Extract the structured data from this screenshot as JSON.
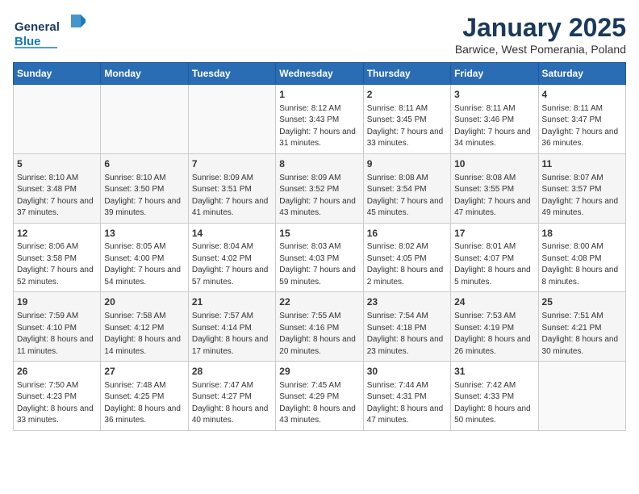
{
  "header": {
    "logo_general": "General",
    "logo_blue": "Blue",
    "title": "January 2025",
    "subtitle": "Barwice, West Pomerania, Poland"
  },
  "calendar": {
    "weekdays": [
      "Sunday",
      "Monday",
      "Tuesday",
      "Wednesday",
      "Thursday",
      "Friday",
      "Saturday"
    ],
    "weeks": [
      [
        {
          "day": "",
          "sunrise": "",
          "sunset": "",
          "daylight": ""
        },
        {
          "day": "",
          "sunrise": "",
          "sunset": "",
          "daylight": ""
        },
        {
          "day": "",
          "sunrise": "",
          "sunset": "",
          "daylight": ""
        },
        {
          "day": "1",
          "sunrise": "Sunrise: 8:12 AM",
          "sunset": "Sunset: 3:43 PM",
          "daylight": "Daylight: 7 hours and 31 minutes."
        },
        {
          "day": "2",
          "sunrise": "Sunrise: 8:11 AM",
          "sunset": "Sunset: 3:45 PM",
          "daylight": "Daylight: 7 hours and 33 minutes."
        },
        {
          "day": "3",
          "sunrise": "Sunrise: 8:11 AM",
          "sunset": "Sunset: 3:46 PM",
          "daylight": "Daylight: 7 hours and 34 minutes."
        },
        {
          "day": "4",
          "sunrise": "Sunrise: 8:11 AM",
          "sunset": "Sunset: 3:47 PM",
          "daylight": "Daylight: 7 hours and 36 minutes."
        }
      ],
      [
        {
          "day": "5",
          "sunrise": "Sunrise: 8:10 AM",
          "sunset": "Sunset: 3:48 PM",
          "daylight": "Daylight: 7 hours and 37 minutes."
        },
        {
          "day": "6",
          "sunrise": "Sunrise: 8:10 AM",
          "sunset": "Sunset: 3:50 PM",
          "daylight": "Daylight: 7 hours and 39 minutes."
        },
        {
          "day": "7",
          "sunrise": "Sunrise: 8:09 AM",
          "sunset": "Sunset: 3:51 PM",
          "daylight": "Daylight: 7 hours and 41 minutes."
        },
        {
          "day": "8",
          "sunrise": "Sunrise: 8:09 AM",
          "sunset": "Sunset: 3:52 PM",
          "daylight": "Daylight: 7 hours and 43 minutes."
        },
        {
          "day": "9",
          "sunrise": "Sunrise: 8:08 AM",
          "sunset": "Sunset: 3:54 PM",
          "daylight": "Daylight: 7 hours and 45 minutes."
        },
        {
          "day": "10",
          "sunrise": "Sunrise: 8:08 AM",
          "sunset": "Sunset: 3:55 PM",
          "daylight": "Daylight: 7 hours and 47 minutes."
        },
        {
          "day": "11",
          "sunrise": "Sunrise: 8:07 AM",
          "sunset": "Sunset: 3:57 PM",
          "daylight": "Daylight: 7 hours and 49 minutes."
        }
      ],
      [
        {
          "day": "12",
          "sunrise": "Sunrise: 8:06 AM",
          "sunset": "Sunset: 3:58 PM",
          "daylight": "Daylight: 7 hours and 52 minutes."
        },
        {
          "day": "13",
          "sunrise": "Sunrise: 8:05 AM",
          "sunset": "Sunset: 4:00 PM",
          "daylight": "Daylight: 7 hours and 54 minutes."
        },
        {
          "day": "14",
          "sunrise": "Sunrise: 8:04 AM",
          "sunset": "Sunset: 4:02 PM",
          "daylight": "Daylight: 7 hours and 57 minutes."
        },
        {
          "day": "15",
          "sunrise": "Sunrise: 8:03 AM",
          "sunset": "Sunset: 4:03 PM",
          "daylight": "Daylight: 7 hours and 59 minutes."
        },
        {
          "day": "16",
          "sunrise": "Sunrise: 8:02 AM",
          "sunset": "Sunset: 4:05 PM",
          "daylight": "Daylight: 8 hours and 2 minutes."
        },
        {
          "day": "17",
          "sunrise": "Sunrise: 8:01 AM",
          "sunset": "Sunset: 4:07 PM",
          "daylight": "Daylight: 8 hours and 5 minutes."
        },
        {
          "day": "18",
          "sunrise": "Sunrise: 8:00 AM",
          "sunset": "Sunset: 4:08 PM",
          "daylight": "Daylight: 8 hours and 8 minutes."
        }
      ],
      [
        {
          "day": "19",
          "sunrise": "Sunrise: 7:59 AM",
          "sunset": "Sunset: 4:10 PM",
          "daylight": "Daylight: 8 hours and 11 minutes."
        },
        {
          "day": "20",
          "sunrise": "Sunrise: 7:58 AM",
          "sunset": "Sunset: 4:12 PM",
          "daylight": "Daylight: 8 hours and 14 minutes."
        },
        {
          "day": "21",
          "sunrise": "Sunrise: 7:57 AM",
          "sunset": "Sunset: 4:14 PM",
          "daylight": "Daylight: 8 hours and 17 minutes."
        },
        {
          "day": "22",
          "sunrise": "Sunrise: 7:55 AM",
          "sunset": "Sunset: 4:16 PM",
          "daylight": "Daylight: 8 hours and 20 minutes."
        },
        {
          "day": "23",
          "sunrise": "Sunrise: 7:54 AM",
          "sunset": "Sunset: 4:18 PM",
          "daylight": "Daylight: 8 hours and 23 minutes."
        },
        {
          "day": "24",
          "sunrise": "Sunrise: 7:53 AM",
          "sunset": "Sunset: 4:19 PM",
          "daylight": "Daylight: 8 hours and 26 minutes."
        },
        {
          "day": "25",
          "sunrise": "Sunrise: 7:51 AM",
          "sunset": "Sunset: 4:21 PM",
          "daylight": "Daylight: 8 hours and 30 minutes."
        }
      ],
      [
        {
          "day": "26",
          "sunrise": "Sunrise: 7:50 AM",
          "sunset": "Sunset: 4:23 PM",
          "daylight": "Daylight: 8 hours and 33 minutes."
        },
        {
          "day": "27",
          "sunrise": "Sunrise: 7:48 AM",
          "sunset": "Sunset: 4:25 PM",
          "daylight": "Daylight: 8 hours and 36 minutes."
        },
        {
          "day": "28",
          "sunrise": "Sunrise: 7:47 AM",
          "sunset": "Sunset: 4:27 PM",
          "daylight": "Daylight: 8 hours and 40 minutes."
        },
        {
          "day": "29",
          "sunrise": "Sunrise: 7:45 AM",
          "sunset": "Sunset: 4:29 PM",
          "daylight": "Daylight: 8 hours and 43 minutes."
        },
        {
          "day": "30",
          "sunrise": "Sunrise: 7:44 AM",
          "sunset": "Sunset: 4:31 PM",
          "daylight": "Daylight: 8 hours and 47 minutes."
        },
        {
          "day": "31",
          "sunrise": "Sunrise: 7:42 AM",
          "sunset": "Sunset: 4:33 PM",
          "daylight": "Daylight: 8 hours and 50 minutes."
        },
        {
          "day": "",
          "sunrise": "",
          "sunset": "",
          "daylight": ""
        }
      ]
    ]
  }
}
